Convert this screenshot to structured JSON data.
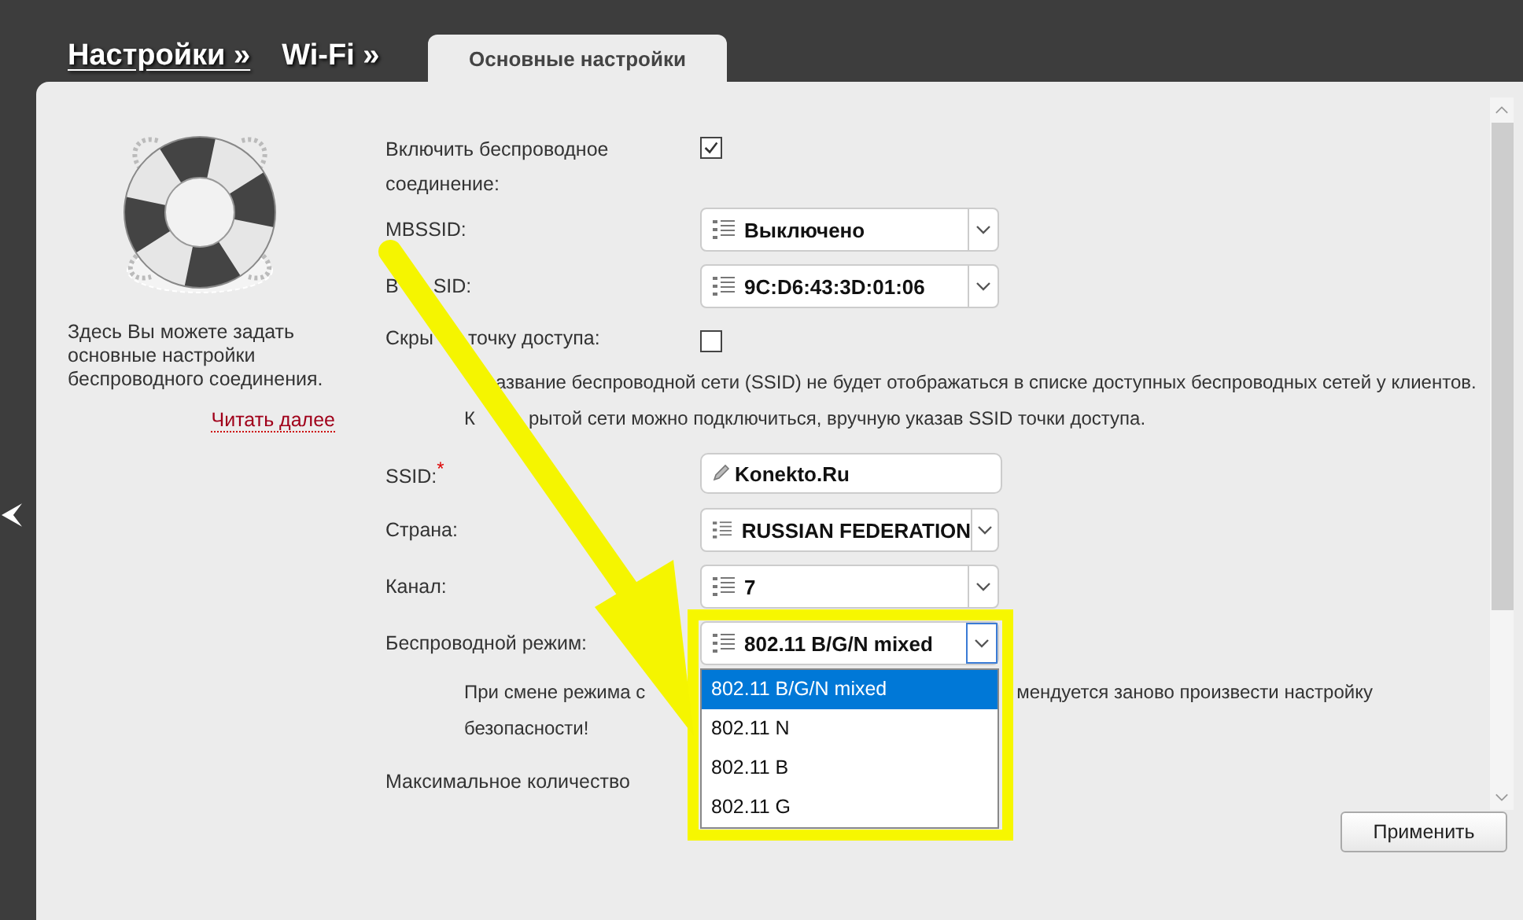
{
  "breadcrumb": [
    {
      "label": "Настройки »",
      "link": true
    },
    {
      "label": "Wi-Fi »",
      "link": false
    }
  ],
  "tabs": [
    {
      "label": "Основные настройки",
      "selected": true
    }
  ],
  "help": {
    "text": "Здесь Вы можете задать основные настройки беспроводного соединения.",
    "link": "Читать далее"
  },
  "form": {
    "rows": [
      {
        "kind": "checkbox",
        "label": [
          "Включить беспроводное соединение:"
        ],
        "checked": true
      },
      {
        "kind": "select",
        "label": [
          "MBSSID:"
        ],
        "value": "Выключено"
      },
      {
        "kind": "select",
        "label": [
          "B",
          "SID:"
        ],
        "value": "9C:D6:43:3D:01:06"
      },
      {
        "kind": "checkbox",
        "label": [
          "Скры",
          "точку доступа:"
        ],
        "checked": false
      },
      {
        "kind": "note",
        "lines": [
          {
            "parts": [
              "азвание беспроводной сети (SSID) не будет отображаться в списке доступных беспроводных сетей у клиентов."
            ]
          },
          {
            "parts": [
              "К",
              "рытой сети можно подключиться, вручную указав SSID точки доступа."
            ]
          }
        ]
      },
      {
        "kind": "input",
        "label": [
          "SSID:"
        ],
        "mark": "*",
        "value": "Konekto.Ru"
      },
      {
        "kind": "select",
        "label": [
          "Страна:"
        ],
        "value": "RUSSIAN FEDERATION"
      },
      {
        "kind": "select",
        "label": [
          "Канал:"
        ],
        "value": "7"
      },
      {
        "kind": "select",
        "label": [
          "Беспроводной режим:"
        ],
        "value": "802.11 B/G/N mixed",
        "open": true,
        "options": [
          {
            "label": "802.11 B/G/N mixed",
            "selected": true
          },
          {
            "label": "802.11 N",
            "selected": false
          },
          {
            "label": "802.11 B",
            "selected": false
          },
          {
            "label": "802.11 G",
            "selected": false
          }
        ]
      },
      {
        "kind": "note",
        "lines": [
          {
            "parts": [
              "При смене режима с",
              "мендуется заново произвести настройку"
            ]
          },
          {
            "parts": [
              "безопасности!"
            ]
          }
        ]
      },
      {
        "kind": "text",
        "label": [
          "Максимальное количество"
        ]
      }
    ]
  },
  "apply_button": "Применить"
}
